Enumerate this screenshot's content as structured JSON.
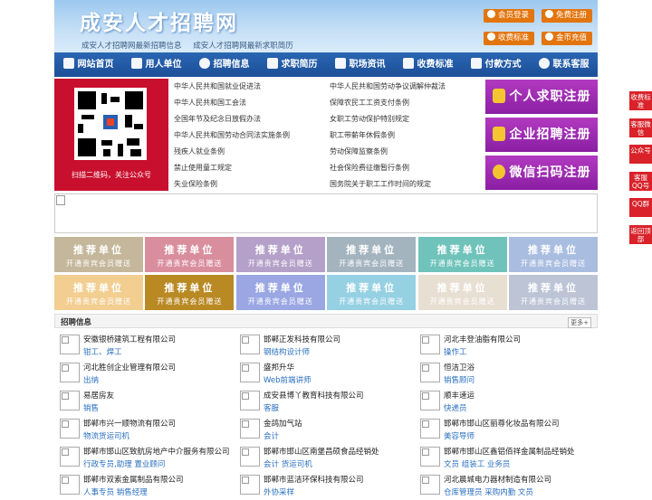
{
  "header": {
    "title": "成安人才招聘网",
    "subtitles": [
      "成安人才招聘网最新招聘信息",
      "成安人才招聘网最新求职简历"
    ],
    "buttons": [
      {
        "label": "会员登录",
        "icon": "user-icon"
      },
      {
        "label": "免费注册",
        "icon": "register-icon"
      },
      {
        "label": "收费标准",
        "icon": "price-icon"
      },
      {
        "label": "金币充值",
        "icon": "coin-icon"
      }
    ]
  },
  "nav": [
    {
      "label": "网站首页",
      "icon": "home-icon"
    },
    {
      "label": "用人单位",
      "icon": "building-icon"
    },
    {
      "label": "招聘信息",
      "icon": "person-icon"
    },
    {
      "label": "求职简历",
      "icon": "resume-icon"
    },
    {
      "label": "职场资讯",
      "icon": "news-icon"
    },
    {
      "label": "收费标准",
      "icon": "fee-icon"
    },
    {
      "label": "付款方式",
      "icon": "payment-icon"
    },
    {
      "label": "联系客服",
      "icon": "phone-icon"
    }
  ],
  "qr": {
    "caption": "扫描二维码，关注公众号"
  },
  "laws_left": [
    "中华人民共和国就业促进法",
    "中华人民共和国工会法",
    "全国年节及纪念日放假办法",
    "中华人民共和国劳动合同法实施条例",
    "残疾人就业条例",
    "禁止使用童工规定",
    "失业保险条例"
  ],
  "laws_right": [
    "中华人民共和国劳动争议调解仲裁法",
    "保障农民工工资支付条例",
    "女职工劳动保护特别规定",
    "职工带薪年休假条例",
    "劳动保障监察条例",
    "社会保险费征缴暂行条例",
    "国务院关于职工工作时间的规定"
  ],
  "register": [
    {
      "label": "个人求职注册",
      "icon": "person-register-icon"
    },
    {
      "label": "企业招聘注册",
      "icon": "company-register-icon"
    },
    {
      "label": "微信扫码注册",
      "icon": "wechat-icon"
    }
  ],
  "recommend": {
    "title": "推荐单位",
    "sub": "开通贵宾会员赠送",
    "colors": [
      "#c4b79b",
      "#d98e9e",
      "#b4a0c8",
      "#a4b4bf",
      "#6fc3bb",
      "#a9bde0",
      "#f2ce91",
      "#b98924",
      "#9aa7e3",
      "#96d0e3",
      "#e8dfd3",
      "#bcc4d6"
    ]
  },
  "jobs": {
    "title": "招聘信息",
    "more": "更多+",
    "items": [
      {
        "company": "安徽银桥建筑工程有限公司",
        "positions": "钳工、焊工"
      },
      {
        "company": "邯郸正发科技有限公司",
        "positions": "钢结构设计师"
      },
      {
        "company": "河北丰登油脂有限公司",
        "positions": "操作工"
      },
      {
        "company": "河北胜创企业管理有限公司",
        "positions": "出纳"
      },
      {
        "company": "盛邦升华",
        "positions": "Web前端讲师"
      },
      {
        "company": "恒洁卫浴",
        "positions": "销售顾问"
      },
      {
        "company": "易居房友",
        "positions": "销售"
      },
      {
        "company": "成安县博丫教育科技有限公司",
        "positions": "客服"
      },
      {
        "company": "顺丰速运",
        "positions": "快递员"
      },
      {
        "company": "邯郸市兴一顺物流有限公司",
        "positions": "物流货运司机"
      },
      {
        "company": "金鸽加气站",
        "positions": "会计"
      },
      {
        "company": "邯郸市邯山区丽尊化妆品有限公司",
        "positions": "美容导师"
      },
      {
        "company": "邯郸市邯山区致航房地产中介服务有限公司",
        "positions": "行政专员,助理  置业顾问"
      },
      {
        "company": "邯郸市邯山区南堡昌硕食品经销处",
        "positions": "会计  货运司机"
      },
      {
        "company": "邯郸市邯山区鑫铝佰祥金属制品经销处",
        "positions": "文员  组装工  业务员"
      },
      {
        "company": "邯郸市双索金属制品有限公司",
        "positions": "人事专员  销售经理"
      },
      {
        "company": "邯郸市蓝洁环保科技有限公司",
        "positions": "外协采样"
      },
      {
        "company": "河北晨城电力器材制造有限公司",
        "positions": "仓库管理员  采购内勤  文员"
      }
    ]
  },
  "float_bar": [
    "收费标准",
    "客服微信",
    "公众号",
    "客服QQ号",
    "QQ群",
    "返回顶部"
  ]
}
